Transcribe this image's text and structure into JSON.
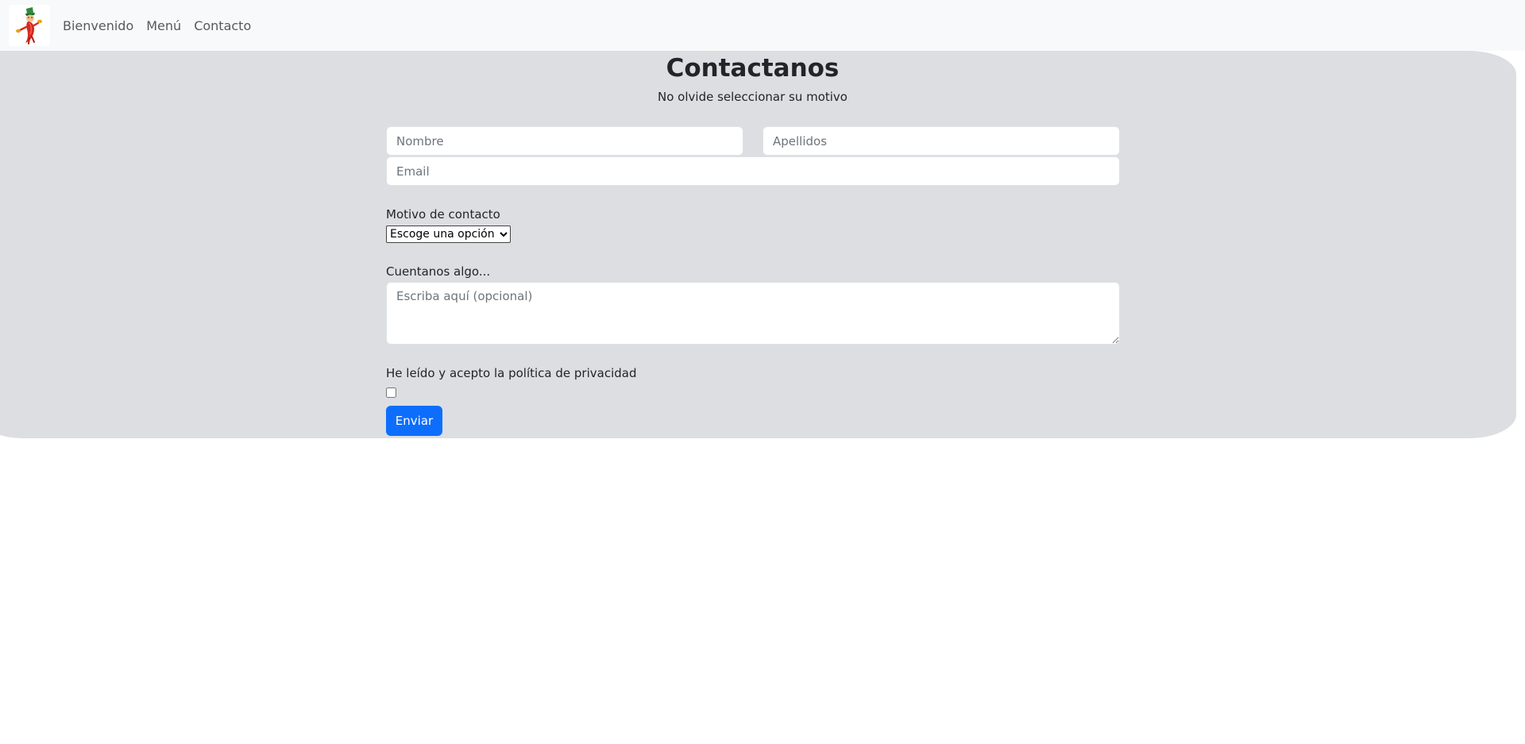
{
  "navbar": {
    "logo_icon": "chili-pepper-mascot-icon",
    "items": [
      {
        "label": "Bienvenido"
      },
      {
        "label": "Menú"
      },
      {
        "label": "Contacto"
      }
    ]
  },
  "contact": {
    "title": "Contactanos",
    "subtitle": "No olvide seleccionar su motivo",
    "first_name": {
      "placeholder": "Nombre",
      "value": ""
    },
    "last_name": {
      "placeholder": "Apellidos",
      "value": ""
    },
    "email": {
      "placeholder": "Email",
      "value": ""
    },
    "reason_label": "Motivo de contacto",
    "reason_select": {
      "selected": "Escoge una opción"
    },
    "message_label": "Cuentanos algo...",
    "message": {
      "placeholder": "Escriba aquí (opcional)",
      "value": ""
    },
    "privacy_label": "He leído y acepto la política de privacidad",
    "privacy_checked": false,
    "submit_label": "Enviar"
  },
  "colors": {
    "navbar_bg": "#f8f9fa",
    "section_bg": "#dcdee2",
    "primary": "#0d6efd"
  }
}
